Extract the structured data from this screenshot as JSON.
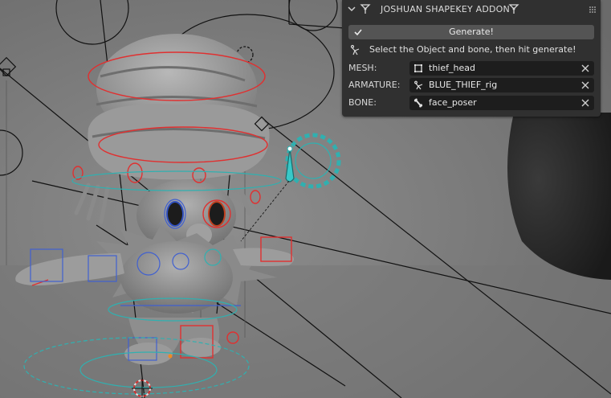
{
  "panel": {
    "title": "JOSHUAN SHAPEKEY ADDON",
    "generate_label": "Generate!",
    "hint": "Select the Object and bone, then hit generate!",
    "fields": [
      {
        "label": "MESH:",
        "value": "thief_head",
        "icon": "mesh-icon"
      },
      {
        "label": "ARMATURE:",
        "value": "BLUE_THIEF_rig",
        "icon": "armature-icon"
      },
      {
        "label": "BONE:",
        "value": "face_poser",
        "icon": "bone-icon"
      }
    ]
  },
  "colors": {
    "panel_bg": "#303030",
    "button_bg": "#545454",
    "field_bg": "#1d1d1d",
    "viewport_bg": "#7d7d7d",
    "rig_red": "#e03030",
    "rig_blue": "#4060d0",
    "rig_cyan": "#30b0b0"
  }
}
